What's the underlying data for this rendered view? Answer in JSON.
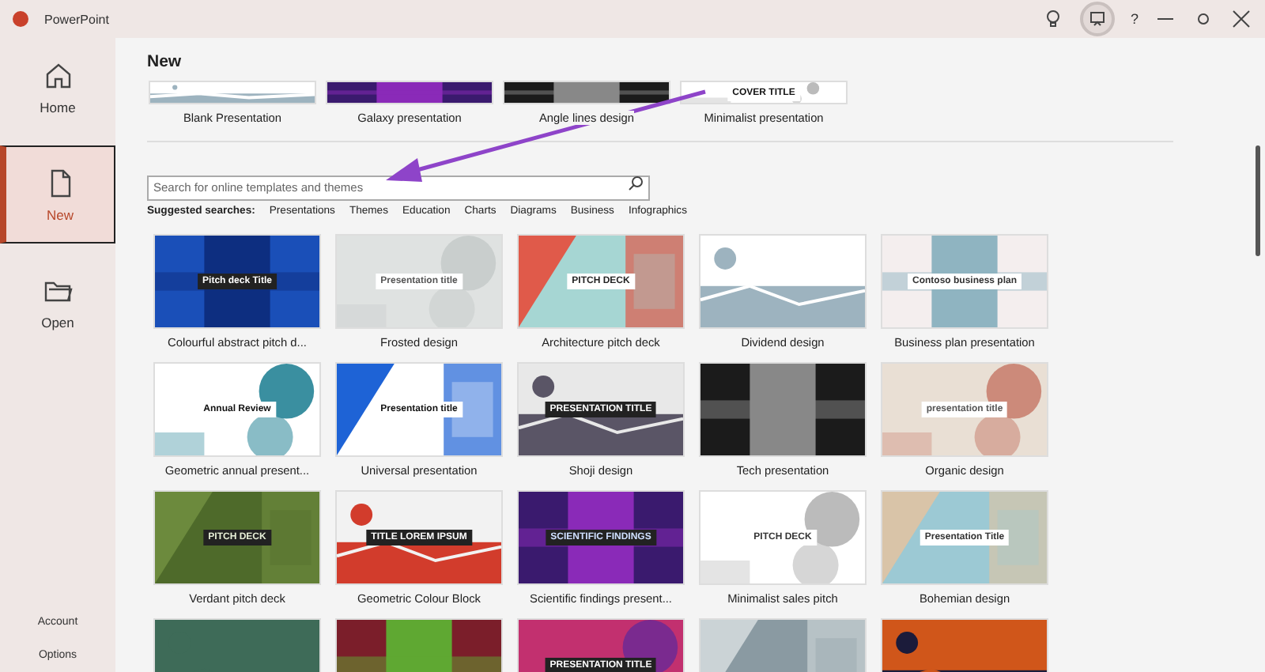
{
  "window": {
    "title": "PowerPoint",
    "help": "?"
  },
  "sidebar": {
    "items": [
      {
        "label": "Home",
        "selected": false
      },
      {
        "label": "New",
        "selected": true
      },
      {
        "label": "Open",
        "selected": false
      }
    ],
    "footer": [
      {
        "label": "Account"
      },
      {
        "label": "Options"
      }
    ]
  },
  "heading": "New",
  "featured": [
    {
      "kind": "template",
      "label": "Blank Presentation"
    },
    {
      "kind": "template",
      "label": "Galaxy presentation"
    },
    {
      "kind": "template",
      "label": "Angle lines design"
    },
    {
      "kind": "template",
      "label": "Minimalist presentation",
      "thumb_title": "COVER TITLE"
    }
  ],
  "search": {
    "placeholder": "Search for online templates and themes"
  },
  "suggested": {
    "label": "Suggested searches:",
    "items": [
      "Presentations",
      "Themes",
      "Education",
      "Charts",
      "Diagrams",
      "Business",
      "Infographics"
    ]
  },
  "templates": [
    {
      "kind": "template",
      "label": "Colourful abstract pitch d...",
      "thumb_title": "Pitch deck Title"
    },
    {
      "kind": "template",
      "label": "Frosted design",
      "thumb_title": "Presentation title"
    },
    {
      "kind": "template",
      "label": "Architecture pitch deck",
      "thumb_title": "PITCH DECK"
    },
    {
      "kind": "template",
      "label": "Dividend design"
    },
    {
      "kind": "template",
      "label": "Business plan presentation",
      "thumb_title": "Contoso business plan"
    },
    {
      "kind": "template",
      "label": "Geometric annual present...",
      "thumb_title": "Annual Review"
    },
    {
      "kind": "template",
      "label": "Universal presentation",
      "thumb_title": "Presentation title"
    },
    {
      "kind": "template",
      "label": "Shoji design",
      "thumb_title": "PRESENTATION TITLE"
    },
    {
      "kind": "template",
      "label": "Tech presentation"
    },
    {
      "kind": "template",
      "label": "Organic design",
      "thumb_title": "presentation title"
    },
    {
      "kind": "template",
      "label": "Verdant pitch deck",
      "thumb_title": "PITCH DECK"
    },
    {
      "kind": "template",
      "label": "Geometric Colour Block",
      "thumb_title": "TITLE LOREM IPSUM"
    },
    {
      "kind": "template",
      "label": "Scientific findings present...",
      "thumb_title": "SCIENTIFIC FINDINGS"
    },
    {
      "kind": "template",
      "label": "Minimalist sales pitch",
      "thumb_title": "PITCH DECK"
    },
    {
      "kind": "template",
      "label": "Bohemian design",
      "thumb_title": "Presentation Title"
    },
    {
      "kind": "picture"
    },
    {
      "kind": "picture"
    },
    {
      "kind": "picture",
      "thumb_title": "PRESENTATION TITLE"
    },
    {
      "kind": "picture"
    },
    {
      "kind": "picture"
    }
  ]
}
